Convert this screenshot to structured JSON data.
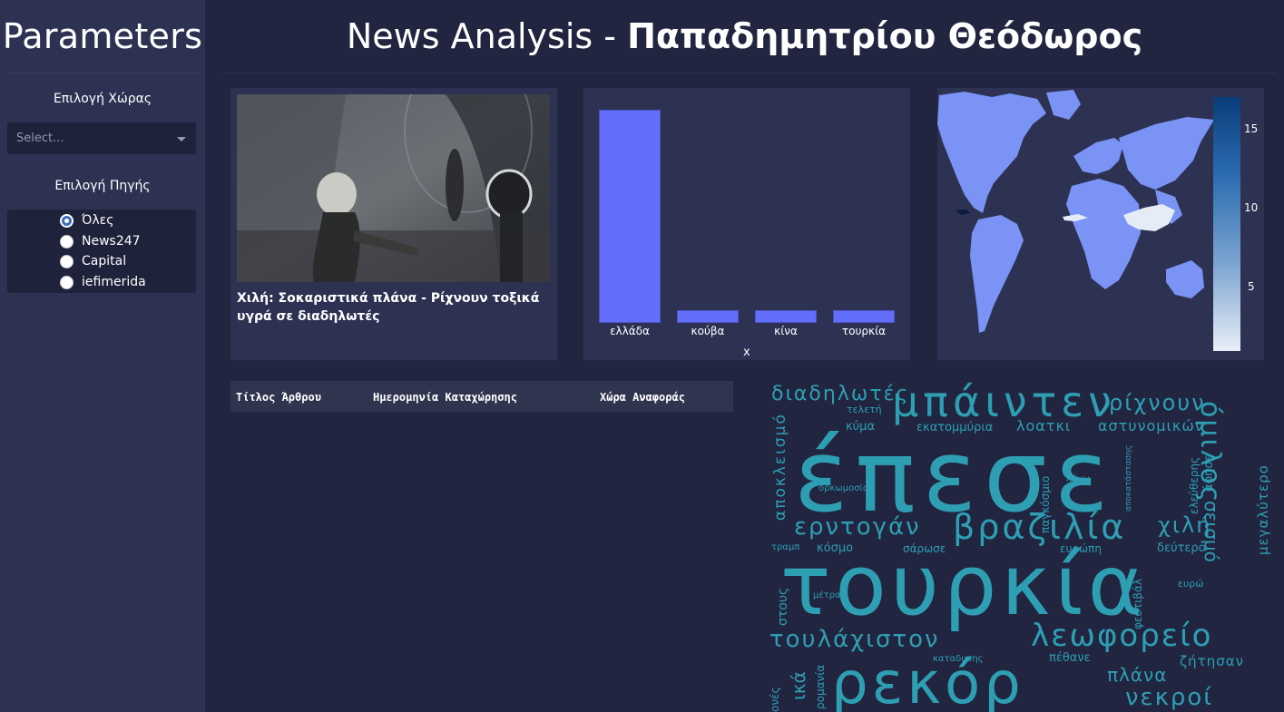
{
  "sidebar": {
    "title": "Parameters",
    "country_label": "Επιλογή Χώρας",
    "country_select": {
      "placeholder": "Select..."
    },
    "source_label": "Επιλογή Πηγής",
    "sources": [
      {
        "label": "Όλες",
        "checked": true
      },
      {
        "label": "News247",
        "checked": false
      },
      {
        "label": "Capital",
        "checked": false
      },
      {
        "label": "iefimerida",
        "checked": false
      }
    ]
  },
  "header": {
    "title_prefix": "News Analysis - ",
    "title_name": "Παπαδημητρίου Θεόδωρος"
  },
  "news_card": {
    "title": "Χιλή: Σοκαριστικά πλάνα - Ρίχνουν τοξικά υγρά σε διαδηλωτές"
  },
  "chart_data": {
    "type": "bar",
    "categories": [
      "ελλάδα",
      "κούβα",
      "κίνα",
      "τουρκία"
    ],
    "values": [
      17,
      1,
      1,
      1
    ],
    "xlabel": "x",
    "ylabel": "",
    "ylim": [
      0,
      17.9
    ],
    "color": "#636efa",
    "grid": false
  },
  "map": {
    "type": "choropleth",
    "highlighted": [
      "Turkey",
      "China",
      "Cuba"
    ],
    "colorbar_ticks": [
      "15",
      "10",
      "5"
    ],
    "colorscale": [
      "#e8eef6",
      "#0b3c7a"
    ],
    "land_color": "#7a93f5"
  },
  "table": {
    "columns": [
      "Τίτλος Άρθρου",
      "Ημερομηνία Καταχώρησης",
      "Χώρα Αναφοράς"
    ],
    "rows": []
  },
  "wordcloud": {
    "words": [
      "διαδηλωτές",
      "μπάιντεν",
      "ρίχνουν",
      "κύμα",
      "τελετή",
      "εκατομμύρια",
      "λοατκι",
      "αστυνομικών",
      "όμιλος",
      "αποκλεισμό",
      "έπεσε",
      "παγκόσμιο",
      "αποκατάστασης",
      "ελεύθερης",
      "άφησε",
      "σεισμό",
      "μεγαλύτερο",
      "λόγω",
      "ορκωμοσίας",
      "ερντογάν",
      "βραζιλία",
      "χιλή",
      "δεύτερο",
      "τραμπ",
      "κόσμο",
      "σάρωσε",
      "ευρώπη",
      "φεστιβάλ",
      "ευρώ",
      "τουρκία",
      "μέτρα",
      "στους",
      "τουλάχιστον",
      "λεωφορείο",
      "καταδυσης",
      "πέθανε",
      "ζήτησαν",
      "ονές",
      "ικά",
      "ρομανία",
      "ρεκόρ",
      "πλάνα",
      "νεκροί"
    ]
  }
}
